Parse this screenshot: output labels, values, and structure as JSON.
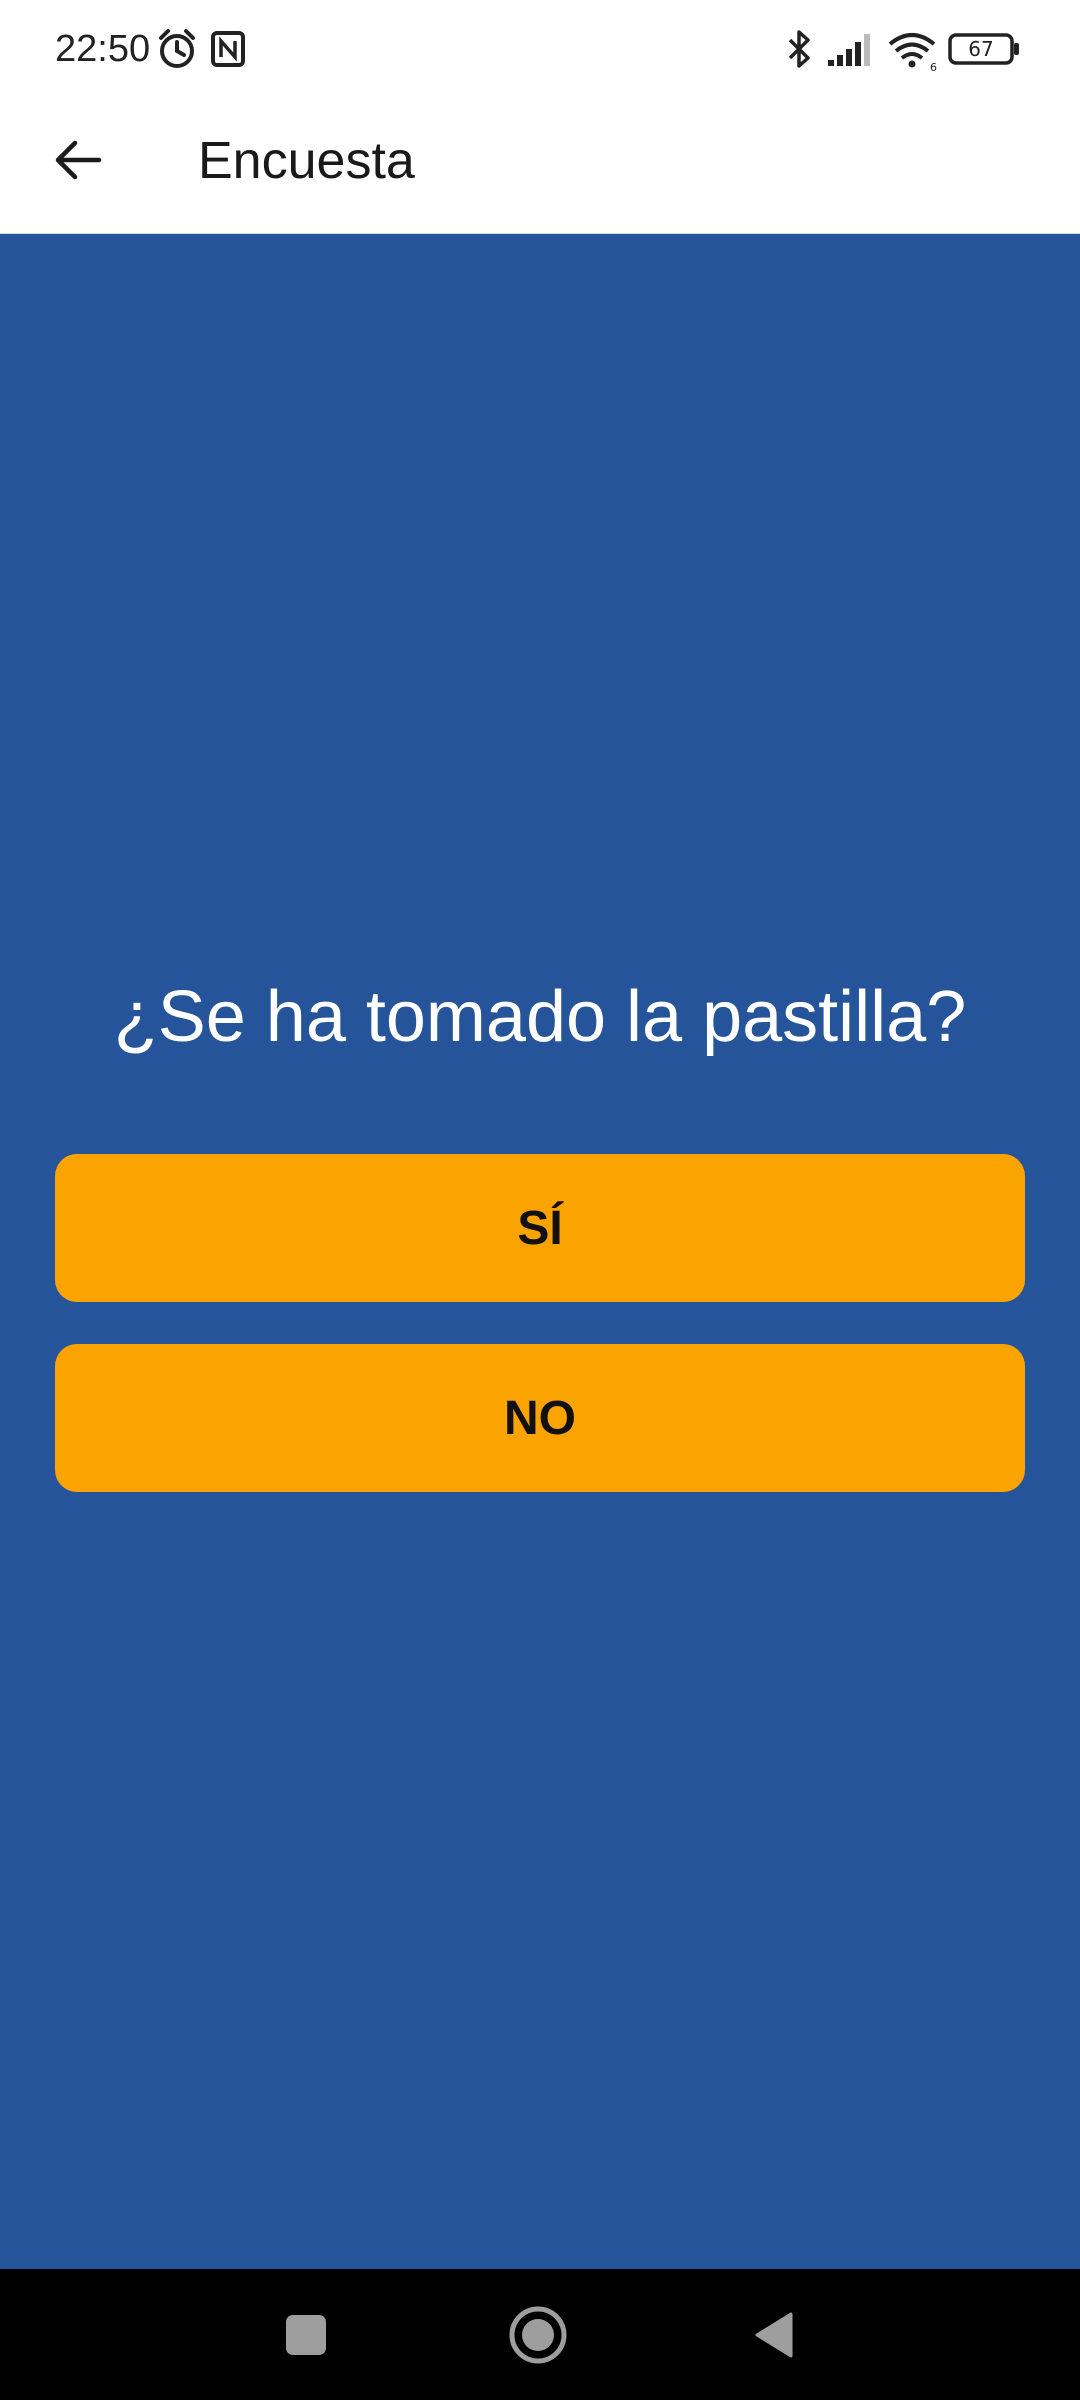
{
  "status_bar": {
    "time": "22:50",
    "battery_level": "67",
    "icons": [
      "alarm-icon",
      "nfc-icon",
      "bluetooth-icon",
      "signal-icon",
      "wifi-icon",
      "battery-icon"
    ]
  },
  "app_bar": {
    "title": "Encuesta",
    "back_icon": "arrow-left-icon"
  },
  "survey": {
    "question": "¿Se ha tomado la pastilla?",
    "yes_label": "SÍ",
    "no_label": "NO"
  },
  "nav_bar": {
    "icons": [
      "recents-square-icon",
      "home-circle-icon",
      "back-triangle-icon"
    ]
  },
  "colors": {
    "background": "#25549a",
    "button": "#fba300",
    "app_bar": "#ffffff",
    "nav_bar": "#000000"
  }
}
